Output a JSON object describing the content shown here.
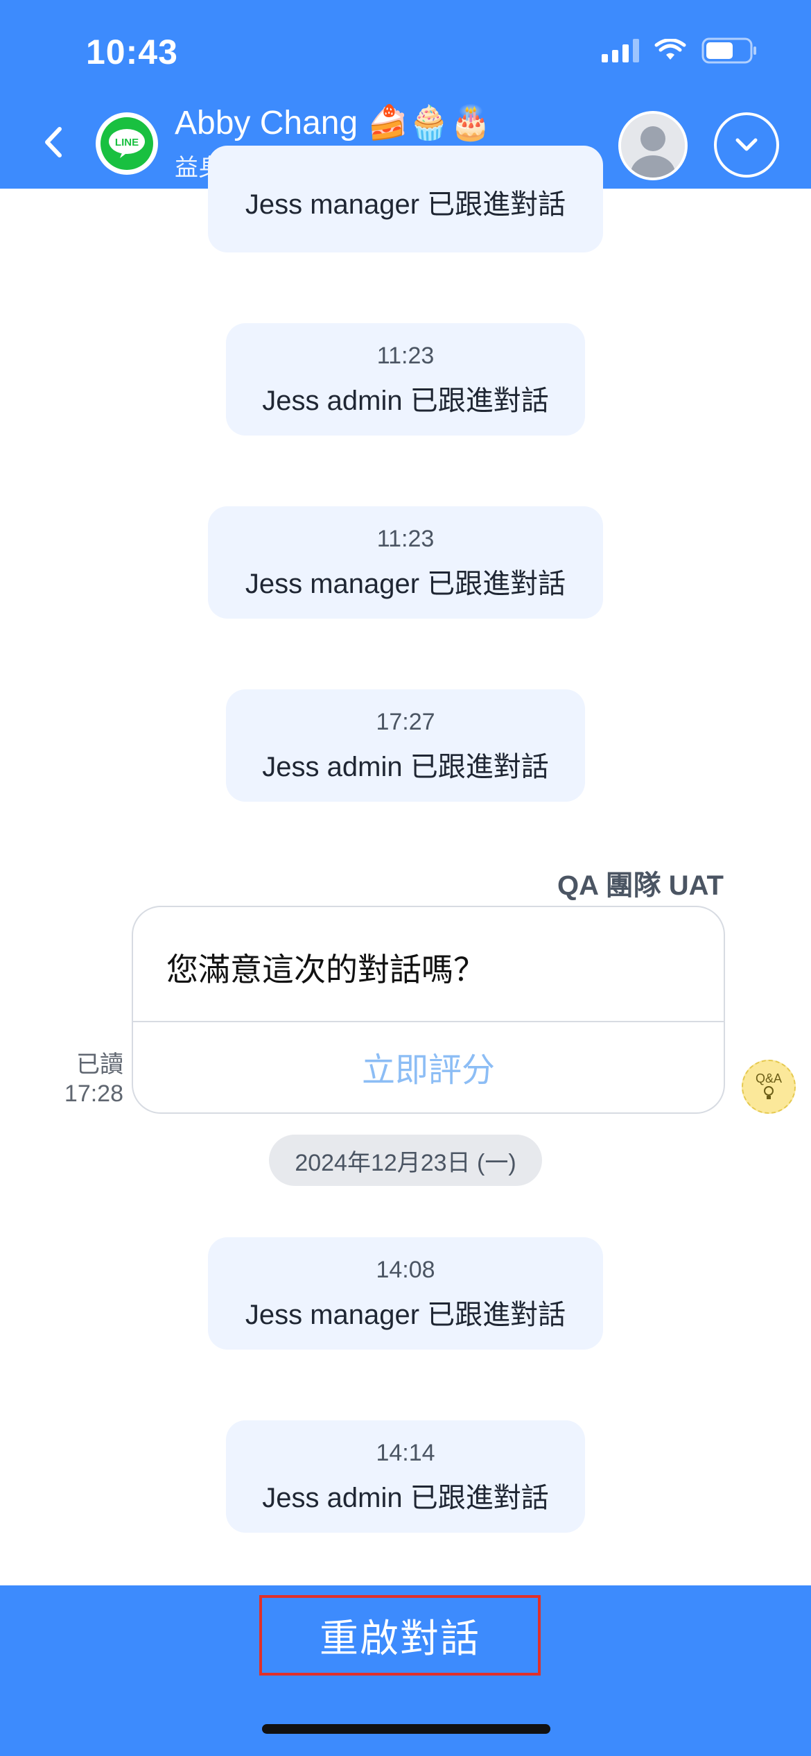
{
  "status_bar": {
    "time": "10:43"
  },
  "header": {
    "contact_name": "Abby Chang 🍰🧁🎂",
    "subtitle": "益身 GYM - UAT",
    "channel_badge": "LINE",
    "icons": [
      "back-chevron-icon",
      "line-logo-icon",
      "avatar-icon",
      "chevron-down-icon"
    ]
  },
  "messages": [
    {
      "time": "",
      "text": "Jess manager 已跟進對話"
    },
    {
      "time": "11:23",
      "text": "Jess admin 已跟進對話"
    },
    {
      "time": "11:23",
      "text": "Jess manager 已跟進對話"
    },
    {
      "time": "17:27",
      "text": "Jess admin 已跟進對話"
    }
  ],
  "survey": {
    "sender": "QA 團隊 UAT",
    "question": "您滿意這次的對話嗎？",
    "action": "立即評分",
    "read_label": "已讀",
    "read_time": "17:28",
    "bot_badge": "Q&A"
  },
  "date_separator": "2024年12月23日 (一)",
  "messages_after": [
    {
      "time": "14:08",
      "text": "Jess manager 已跟進對話"
    },
    {
      "time": "14:14",
      "text": "Jess admin 已跟進對話"
    }
  ],
  "footer": {
    "reopen_label": "重啟對話"
  },
  "colors": {
    "brand_blue": "#3d8bfd",
    "bubble_bg": "#eef4ff",
    "highlight_red": "#e0302a",
    "rate_text": "#8cbdf5"
  }
}
